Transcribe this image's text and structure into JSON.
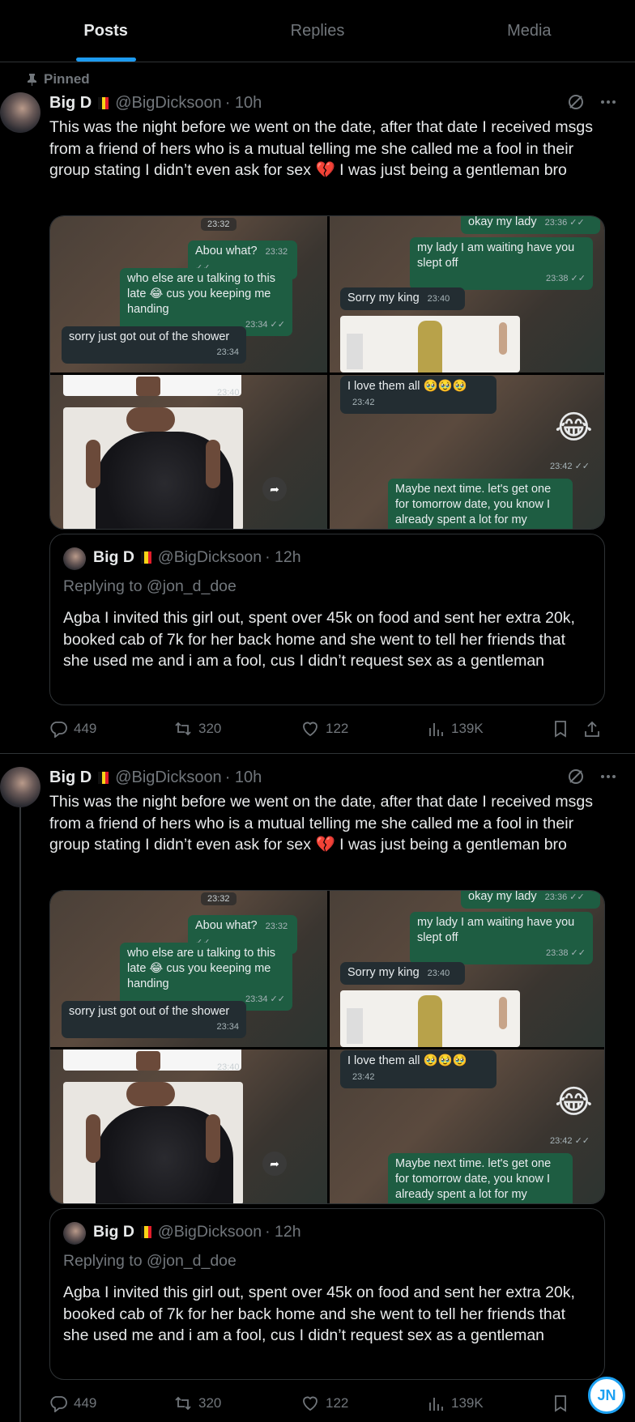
{
  "tabs": [
    {
      "label": "Posts",
      "active": true
    },
    {
      "label": "Replies",
      "active": false
    },
    {
      "label": "Media",
      "active": false
    }
  ],
  "accent_color": "#1d9bf0",
  "posts": [
    {
      "pinned_label": "Pinned",
      "name": "Big D",
      "handle": "@BigDicksoon",
      "time": "· 10h",
      "text_before_emoji": "This was the night before we went on the date, after that date I received msgs from a friend of hers who is a mutual telling me she called me a fool in their  group stating  I didn’t even ask for sex ",
      "emoji": "💔",
      "text_after_emoji": " I was just being a gentleman bro",
      "media": {
        "tl": {
          "time_pill": "23:32",
          "b1_text": "Abou what?",
          "b1_time": "23:32 ✓✓",
          "b2_text": "who else are u talking to this late 😂 cus you keeping me handing",
          "b2_time": "23:34 ✓✓",
          "b3_text": "sorry just got out of the shower",
          "b3_time": "23:34"
        },
        "tr": {
          "b1_text": "okay my lady",
          "b1_time": "23:36 ✓✓",
          "b2_text": "my lady I am waiting  have you slept off",
          "b2_time": "23:38 ✓✓",
          "b3_text": "Sorry my king",
          "b3_time": "23:40"
        },
        "bl": {
          "time_pill": "23:40"
        },
        "br": {
          "b1_text": "I love them all 🥹🥹🥹",
          "b1_time": "23:42",
          "emoji": "😂",
          "emoji_time": "23:42 ✓✓",
          "b2_text": "Maybe next time. let's get one for tomorrow date, you know I already spent a lot for my project this"
        }
      },
      "quote": {
        "name": "Big D",
        "handle": "@BigDicksoon",
        "time": "· 12h",
        "replying": "Replying to @jon_d_doe",
        "text": "Agba I invited this girl out, spent over 45k on food and sent her extra 20k, booked cab of 7k for her back home and she went to tell her friends that she used me and i am a fool, cus I didn’t request sex as a gentleman"
      },
      "stats": {
        "replies": "449",
        "reposts": "320",
        "likes": "122",
        "views": "139K"
      }
    },
    {
      "name": "Big D",
      "handle": "@BigDicksoon",
      "time": "· 10h",
      "text_before_emoji": "This was the night before we went on the date, after that date I received msgs from a friend of hers who is a mutual telling me she called me a fool in their  group stating  I didn’t even ask for sex ",
      "emoji": "💔",
      "text_after_emoji": " I was just being a gentleman bro",
      "quote": {
        "name": "Big D",
        "handle": "@BigDicksoon",
        "time": "· 12h",
        "replying": "Replying to @jon_d_doe",
        "text": "Agba I invited this girl out, spent over 45k on food and sent her extra 20k, booked cab of 7k for her back home and she went to tell her friends that she used me and i am a fool, cus I didn’t request sex as a gentleman"
      },
      "stats": {
        "replies": "449",
        "reposts": "320",
        "likes": "122",
        "views": "139K"
      }
    }
  ],
  "watermark": "JN"
}
